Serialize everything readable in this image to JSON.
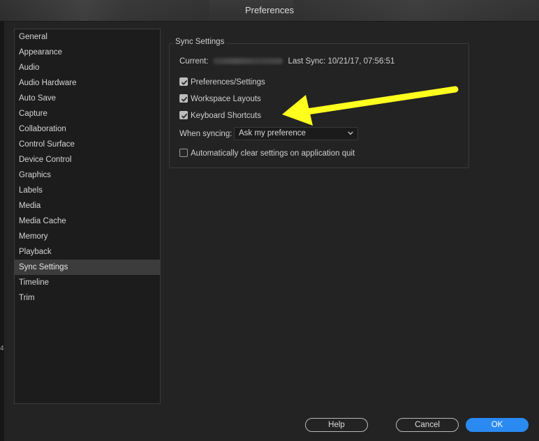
{
  "window": {
    "title": "Preferences"
  },
  "sidebar": {
    "items": [
      {
        "label": "General"
      },
      {
        "label": "Appearance"
      },
      {
        "label": "Audio"
      },
      {
        "label": "Audio Hardware"
      },
      {
        "label": "Auto Save"
      },
      {
        "label": "Capture"
      },
      {
        "label": "Collaboration"
      },
      {
        "label": "Control Surface"
      },
      {
        "label": "Device Control"
      },
      {
        "label": "Graphics"
      },
      {
        "label": "Labels"
      },
      {
        "label": "Media"
      },
      {
        "label": "Media Cache"
      },
      {
        "label": "Memory"
      },
      {
        "label": "Playback"
      },
      {
        "label": "Sync Settings",
        "active": true
      },
      {
        "label": "Timeline"
      },
      {
        "label": "Trim"
      }
    ]
  },
  "sync": {
    "group_title": "Sync Settings",
    "current_label": "Current:",
    "last_sync_label": "Last Sync:",
    "last_sync_value": "10/21/17, 07:56:51",
    "options": [
      {
        "label": "Preferences/Settings",
        "checked": true
      },
      {
        "label": "Workspace Layouts",
        "checked": true
      },
      {
        "label": "Keyboard Shortcuts",
        "checked": true
      }
    ],
    "when_syncing_label": "When syncing:",
    "when_syncing_value": "Ask my preference",
    "auto_clear": {
      "label": "Automatically clear settings on application quit",
      "checked": false
    }
  },
  "buttons": {
    "help": "Help",
    "cancel": "Cancel",
    "ok": "OK"
  },
  "annotation": {
    "arrow_color": "#ffff1e"
  },
  "colors": {
    "accent": "#2a8af2",
    "background": "#232323",
    "sidebar_selected": "#3c3c3c"
  },
  "background_fragment": {
    "text": "4"
  }
}
